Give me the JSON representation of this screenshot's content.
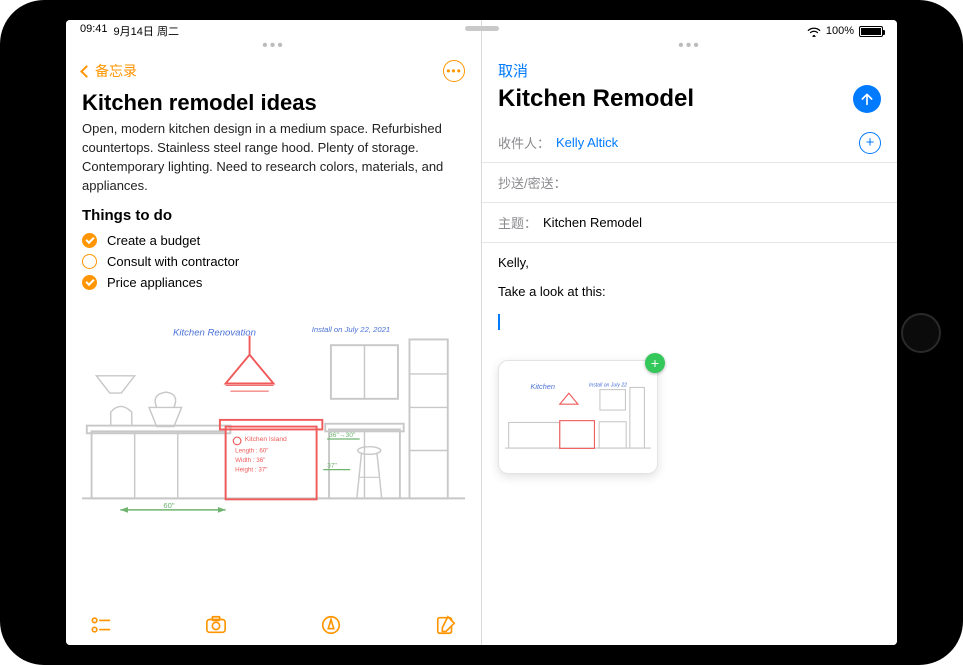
{
  "status": {
    "left_time": "09:41",
    "left_date": "9月14日 周二",
    "battery_pct": "100%"
  },
  "notes": {
    "back_label": "备忘录",
    "title": "Kitchen remodel ideas",
    "description": "Open, modern kitchen design in a medium space. Refurbished countertops. Stainless steel range hood. Plenty of storage. Contemporary lighting. Need to research colors, materials, and appliances.",
    "todo_heading": "Things to do",
    "todos": [
      {
        "label": "Create a budget",
        "done": true
      },
      {
        "label": "Consult with contractor",
        "done": false
      },
      {
        "label": "Price appliances",
        "done": true
      }
    ],
    "drawing_texts": {
      "title": "Kitchen Renovation",
      "install": "Install on July 22, 2021",
      "island_title": "Kitchen Island",
      "island_length": "Length : 60\"",
      "island_width": "Width : 36\"",
      "island_height": "Height : 37\"",
      "dim_left": "60\"",
      "dim_right1": "36\"→30\"",
      "dim_right2": "37\""
    }
  },
  "mail": {
    "cancel_label": "取消",
    "title": "Kitchen Remodel",
    "to_label": "收件人：",
    "to_value": "Kelly Altick",
    "cc_label": "抄送/密送：",
    "subject_label": "主题：",
    "subject_value": "Kitchen Remodel",
    "body_greeting": "Kelly,",
    "body_line": "Take a look at this:"
  }
}
